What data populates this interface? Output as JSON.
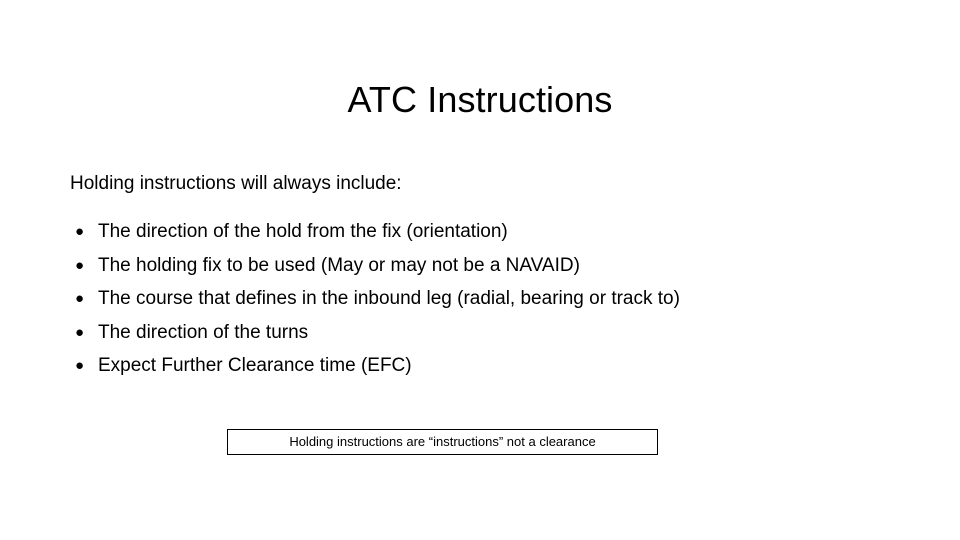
{
  "slide": {
    "title": "ATC Instructions",
    "lead_text": "Holding instructions will always include:",
    "bullet_marker": "●",
    "bullets": [
      {
        "label": "The direction of the hold from the fix (orientation)"
      },
      {
        "label": "The holding fix to be used (May or may not be a NAVAID)"
      },
      {
        "label": "The course that defines in the inbound leg (radial, bearing or track to)"
      },
      {
        "label": "The direction of the turns"
      },
      {
        "label": "Expect Further Clearance time (EFC)"
      }
    ],
    "callout": {
      "text": "Holding instructions are “instructions” not a clearance"
    },
    "colors": {
      "background": "#ffffff",
      "text": "#000000",
      "callout_border": "#000000"
    }
  }
}
